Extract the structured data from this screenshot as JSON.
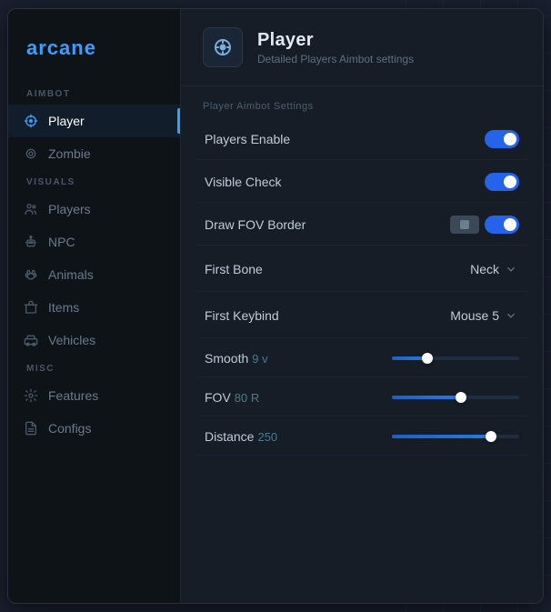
{
  "app": {
    "logo": "arcane",
    "window_title": "arcane"
  },
  "sidebar": {
    "sections": [
      {
        "label": "AIMBOT",
        "items": [
          {
            "id": "player",
            "label": "Player",
            "icon": "crosshair",
            "active": true
          },
          {
            "id": "zombie",
            "label": "Zombie",
            "icon": "target",
            "active": false
          }
        ]
      },
      {
        "label": "VISUALS",
        "items": [
          {
            "id": "players",
            "label": "Players",
            "icon": "users",
            "active": false
          },
          {
            "id": "npc",
            "label": "NPC",
            "icon": "robot",
            "active": false
          },
          {
            "id": "animals",
            "label": "Animals",
            "icon": "paw",
            "active": false
          },
          {
            "id": "items",
            "label": "Items",
            "icon": "box",
            "active": false
          },
          {
            "id": "vehicles",
            "label": "Vehicles",
            "icon": "car",
            "active": false
          }
        ]
      },
      {
        "label": "MISC",
        "items": [
          {
            "id": "features",
            "label": "Features",
            "icon": "gear",
            "active": false
          },
          {
            "id": "configs",
            "label": "Configs",
            "icon": "file",
            "active": false
          }
        ]
      }
    ]
  },
  "page_header": {
    "title": "Player",
    "subtitle": "Detailed Players Aimbot settings"
  },
  "settings": {
    "section_label": "Player Aimbot Settings",
    "rows": [
      {
        "id": "players-enable",
        "label": "Players Enable",
        "type": "toggle",
        "value": true
      },
      {
        "id": "visible-check",
        "label": "Visible Check",
        "type": "toggle",
        "value": true
      },
      {
        "id": "draw-fov-border",
        "label": "Draw FOV Border",
        "type": "toggle-group",
        "value": true
      },
      {
        "id": "first-bone",
        "label": "First Bone",
        "type": "dropdown",
        "value": "Neck"
      },
      {
        "id": "first-keybind",
        "label": "First Keybind",
        "type": "dropdown",
        "value": "Mouse 5"
      },
      {
        "id": "smooth",
        "label": "Smooth",
        "type": "slider",
        "sub_value": "9 v",
        "percent": 28,
        "value": 9
      },
      {
        "id": "fov",
        "label": "FOV",
        "type": "slider",
        "sub_value": "80 R",
        "percent": 54,
        "value": 80
      },
      {
        "id": "distance",
        "label": "Distance",
        "type": "slider",
        "sub_value": "250",
        "percent": 78,
        "value": 250
      }
    ]
  }
}
